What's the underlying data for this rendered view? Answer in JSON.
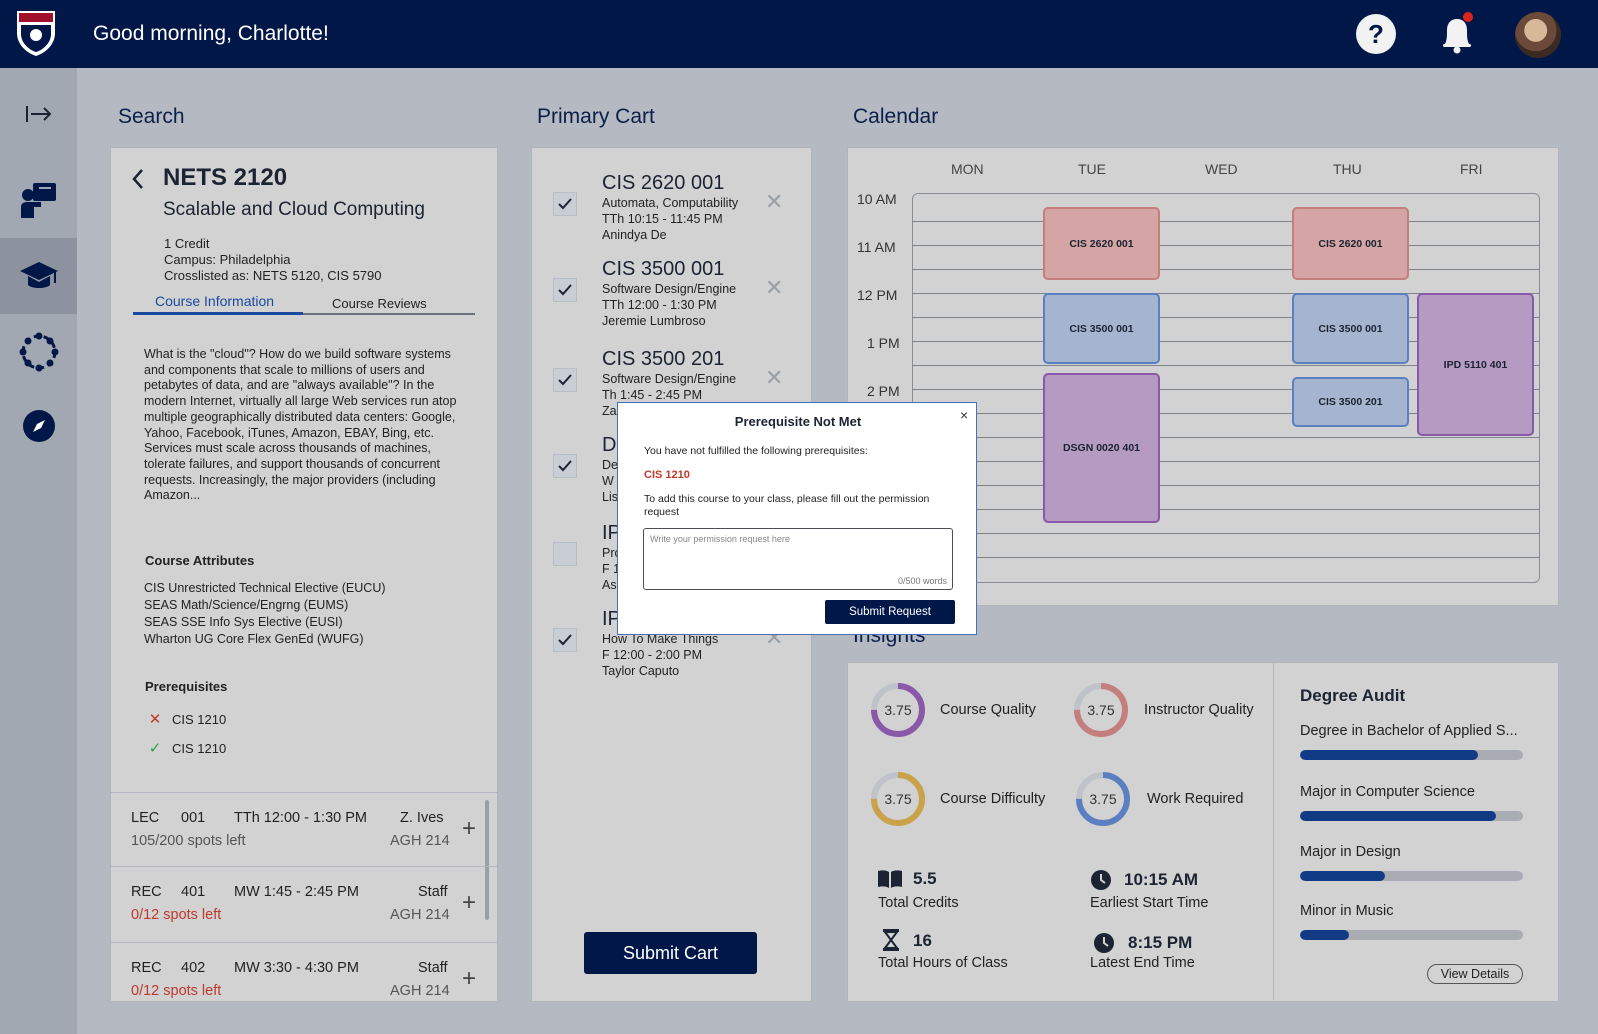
{
  "header": {
    "greeting": "Good morning, Charlotte!",
    "help_label": "?"
  },
  "sidebar": {
    "items": [
      {
        "icon": "collapse-arrow-icon"
      },
      {
        "icon": "teacher-icon"
      },
      {
        "icon": "graduation-cap-icon",
        "active": true
      },
      {
        "icon": "network-circle-icon"
      },
      {
        "icon": "compass-icon"
      }
    ]
  },
  "search": {
    "title": "Search",
    "course_code": "NETS 2120",
    "course_name": "Scalable and Cloud Computing",
    "credit": "1 Credit",
    "campus": "Campus: Philadelphia",
    "crosslisted": "Crosslisted as: NETS 5120, CIS 5790",
    "tab_info": "Course Information",
    "tab_reviews": "Course Reviews",
    "description": "What is the \"cloud\"? How do we build software systems and components that scale to millions of users and petabytes of data, and are \"always available\"? In the modern Internet, virtually all large Web services run atop multiple geographically distributed data centers: Google, Yahoo, Facebook, iTunes, Amazon, EBAY, Bing, etc. Services must scale across thousands of machines, tolerate failures, and support thousands of concurrent requests. Increasingly, the major providers (including Amazon...",
    "attributes_title": "Course Attributes",
    "attributes": [
      "CIS Unrestricted Technical Elective (EUCU)",
      "SEAS Math/Science/Engrng (EUMS)",
      "SEAS SSE Info Sys Elective (EUSI)",
      "Wharton UG Core Flex GenEd (WUFG)"
    ],
    "prereq_title": "Prerequisites",
    "prereqs": [
      {
        "code": "CIS 1210",
        "met": false,
        "mark": "✕"
      },
      {
        "code": "CIS 1210",
        "met": true,
        "mark": "✓"
      }
    ],
    "sections": [
      {
        "type": "LEC",
        "num": "001",
        "time": "TTh 12:00 - 1:30 PM",
        "instructor": "Z. Ives",
        "spots": "105/200 spots left",
        "room": "AGH 214",
        "full": false
      },
      {
        "type": "REC",
        "num": "401",
        "time": "MW 1:45 - 2:45 PM",
        "instructor": "Staff",
        "spots": "0/12 spots left",
        "room": "AGH 214",
        "full": true
      },
      {
        "type": "REC",
        "num": "402",
        "time": "MW 3:30 - 4:30 PM",
        "instructor": "Staff",
        "spots": "0/12 spots left",
        "room": "AGH 214",
        "full": true
      }
    ]
  },
  "cart": {
    "title": "Primary Cart",
    "items": [
      {
        "code": "CIS 2620 001",
        "name": "Automata, Computability",
        "time": "TTh 10:15 - 11:45 PM",
        "instructor": "Anindya De",
        "checked": true
      },
      {
        "code": "CIS 3500 001",
        "name": "Software Design/Engine",
        "time": "TTh 12:00 - 1:30 PM",
        "instructor": "Jeremie Lumbroso",
        "checked": true
      },
      {
        "code": "CIS 3500 201",
        "name": "Software Design/Engine",
        "time": "Th 1:45 - 2:45 PM",
        "instructor": "Za",
        "checked": true
      },
      {
        "code": "D",
        "name": "De",
        "time": "W",
        "instructor": "Lis",
        "checked": true
      },
      {
        "code": "IP",
        "name": "Pro",
        "time": "F 1",
        "instructor": "As",
        "checked": false
      },
      {
        "code": "IP",
        "name": "How To Make Things",
        "time": "F 12:00 - 2:00 PM",
        "instructor": "Taylor Caputo",
        "checked": true
      }
    ],
    "submit_label": "Submit Cart"
  },
  "calendar": {
    "title": "Calendar",
    "days": [
      "MON",
      "TUE",
      "WED",
      "THU",
      "FRI"
    ],
    "times": [
      "10 AM",
      "11 AM",
      "12 PM",
      "1 PM",
      "2 PM"
    ],
    "events": [
      {
        "label": "CIS 2620 001",
        "color": "red"
      },
      {
        "label": "CIS 2620 001",
        "color": "red"
      },
      {
        "label": "CIS 3500 001",
        "color": "blue"
      },
      {
        "label": "CIS 3500 001",
        "color": "blue"
      },
      {
        "label": "CIS 3500 201",
        "color": "blue"
      },
      {
        "label": "DSGN 0020 401",
        "color": "purple"
      },
      {
        "label": "IPD 5110 401",
        "color": "purple"
      }
    ]
  },
  "modal": {
    "title": "Prerequisite Not Met",
    "close": "×",
    "message": "You have not fulfilled the following prerequisites:",
    "code": "CIS 1210",
    "instructions": "To add this course to your class, please fill out the permission request",
    "placeholder": "Write your permission request here",
    "count": "0/500 words",
    "submit_label": "Submit Request"
  },
  "insights": {
    "title": "Insights",
    "ratings": [
      {
        "label": "Course Quality",
        "value": "3.75",
        "color": "#8a58a8"
      },
      {
        "label": "Instructor Quality",
        "value": "3.75",
        "color": "#c47e7e"
      },
      {
        "label": "Course Difficulty",
        "value": "3.75",
        "color": "#c9a24a"
      },
      {
        "label": "Work Required",
        "value": "3.75",
        "color": "#5b7fc0"
      }
    ],
    "stats": [
      {
        "value": "5.5",
        "label": "Total Credits",
        "icon": "book-icon"
      },
      {
        "value": "10:15 AM",
        "label": "Earliest Start Time",
        "icon": "clock-icon"
      },
      {
        "value": "16",
        "label": "Total Hours of Class",
        "icon": "hourglass-icon"
      },
      {
        "value": "8:15 PM",
        "label": "Latest End Time",
        "icon": "clock-icon"
      }
    ]
  },
  "audit": {
    "title": "Degree Audit",
    "items": [
      {
        "label": "Degree in Bachelor of Applied S...",
        "progress": 0.8
      },
      {
        "label": "Major in Computer Science",
        "progress": 0.88
      },
      {
        "label": "Major in Design",
        "progress": 0.38
      },
      {
        "label": "Minor in Music",
        "progress": 0.22
      }
    ],
    "view_details": "View Details"
  }
}
